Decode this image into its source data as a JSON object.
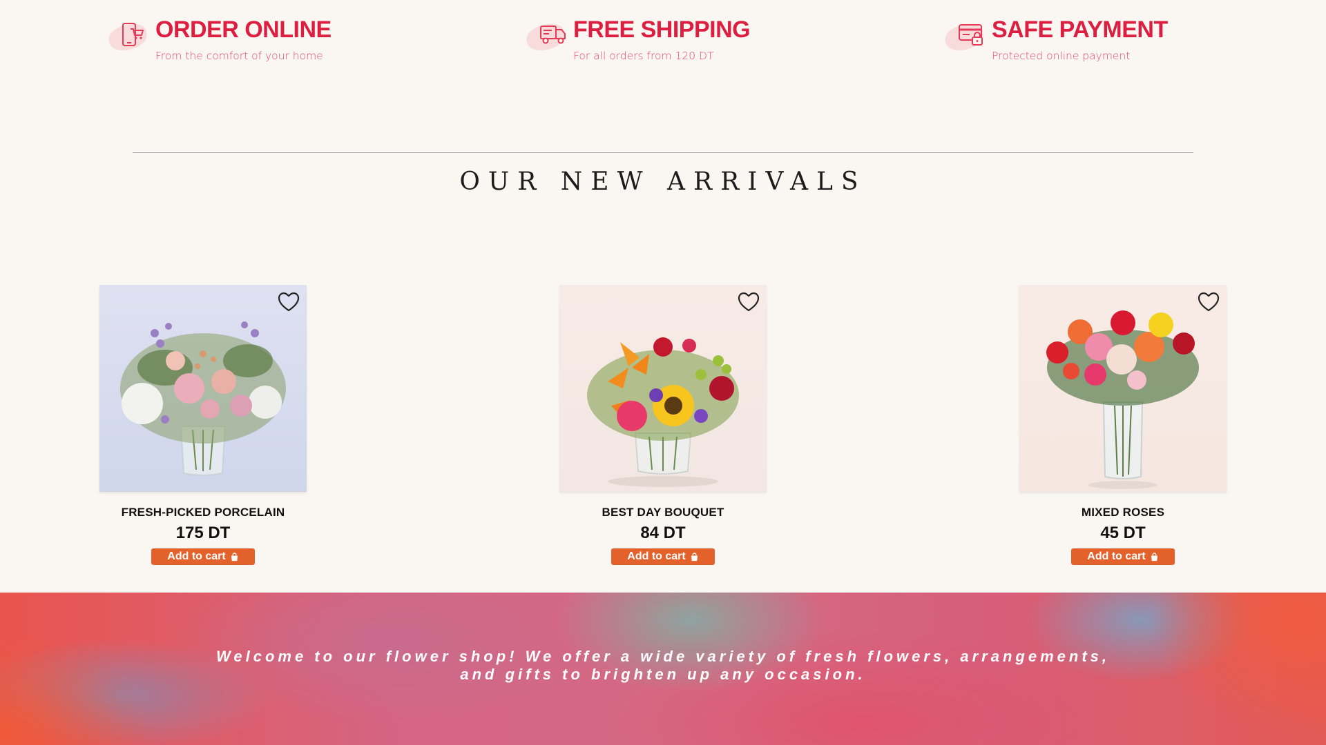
{
  "features": [
    {
      "title": "ORDER ONLINE",
      "subtitle": "From the comfort of your home",
      "icon": "phone-cart-icon"
    },
    {
      "title": "FREE SHIPPING",
      "subtitle": "For all orders from 120 DT",
      "icon": "delivery-truck-icon"
    },
    {
      "title": "SAFE PAYMENT",
      "subtitle": "Protected online payment",
      "icon": "secure-card-icon"
    }
  ],
  "section": {
    "title": "OUR NEW ARRIVALS"
  },
  "products": [
    {
      "name": "FRESH-PICKED PORCELAIN",
      "price": "175 DT",
      "cart_label": "Add to cart"
    },
    {
      "name": "BEST DAY BOUQUET",
      "price": "84 DT",
      "cart_label": "Add to cart"
    },
    {
      "name": "MIXED ROSES",
      "price": "45 DT",
      "cart_label": "Add to cart"
    }
  ],
  "banner": {
    "text": "Welcome to our flower shop! We offer a wide variety of fresh flowers, arrangements, and gifts to brighten up any occasion."
  },
  "colors": {
    "accent_red": "#dc1e40",
    "button_orange": "#e3612a",
    "page_bg": "#faf7f2"
  }
}
